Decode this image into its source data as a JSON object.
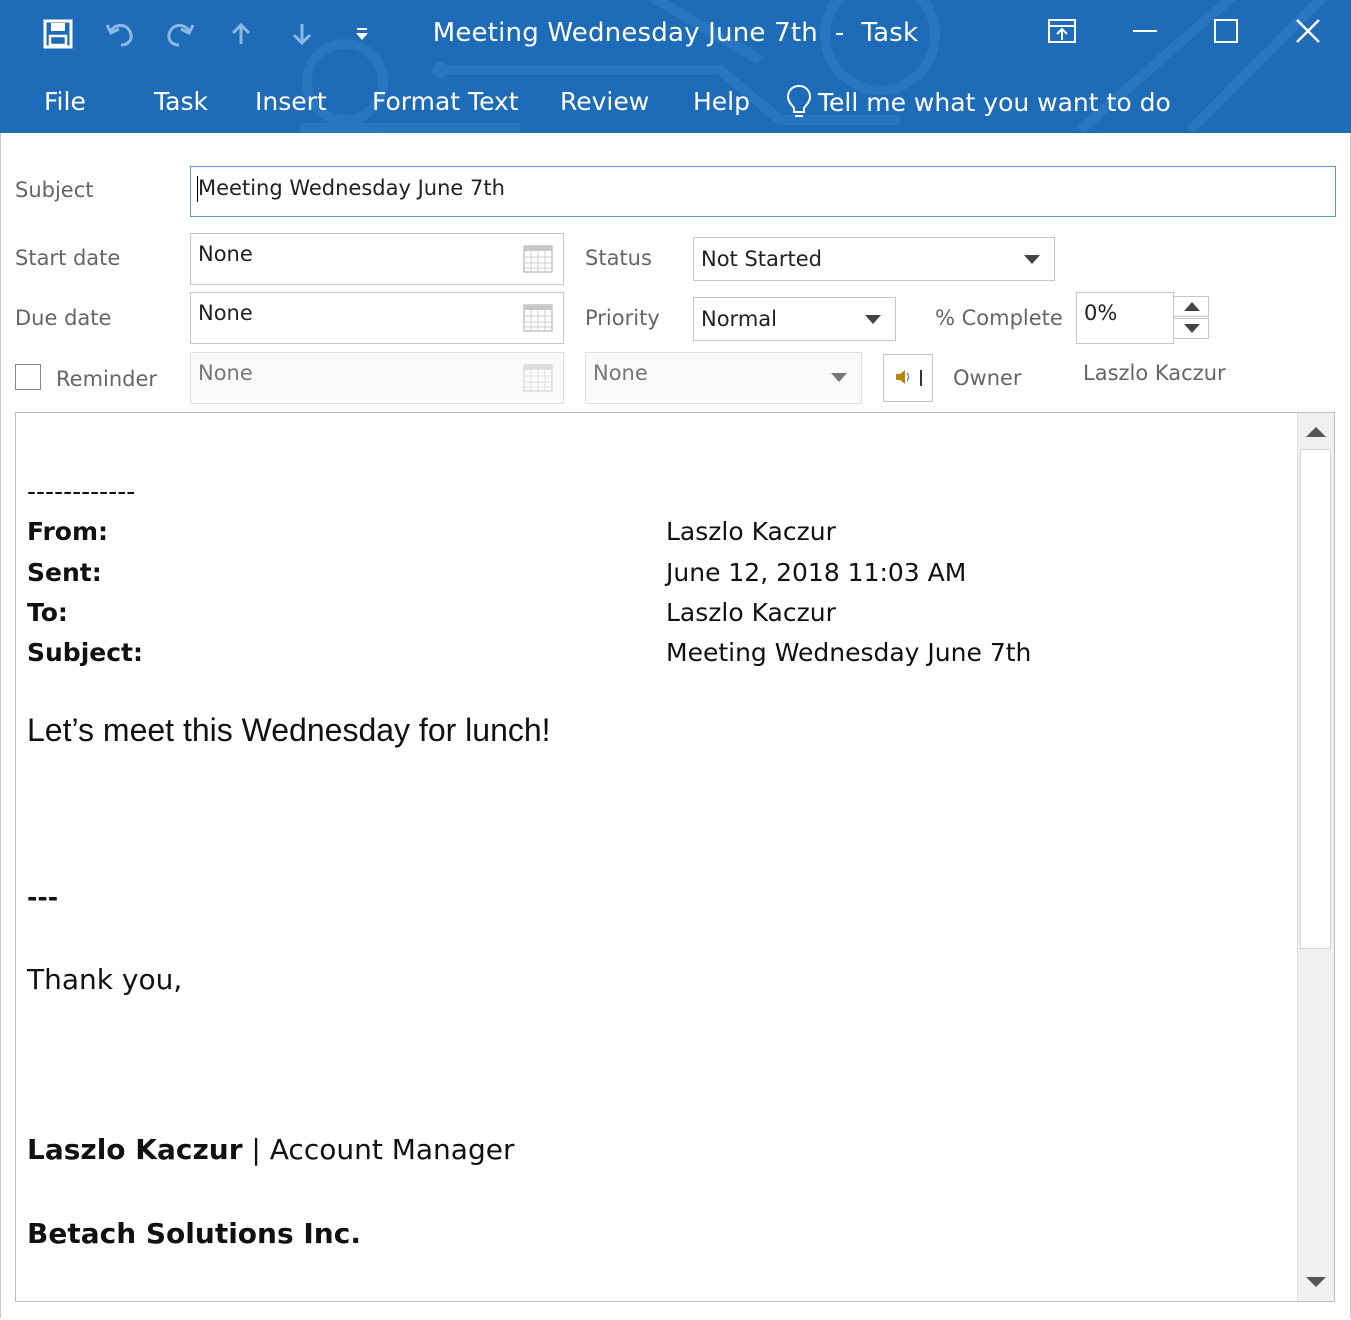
{
  "window": {
    "title_main": "Meeting Wednesday June 7th",
    "title_sep": "-",
    "title_kind": "Task"
  },
  "menu": {
    "items": [
      "File",
      "Task",
      "Insert",
      "Format Text",
      "Review",
      "Help"
    ],
    "tell_me": "Tell me what you want to do"
  },
  "form": {
    "subject_label": "Subject",
    "subject_value": "Meeting Wednesday June 7th",
    "start_label": "Start date",
    "start_value": "None",
    "due_label": "Due date",
    "due_value": "None",
    "reminder_label": "Reminder",
    "reminder_date": "None",
    "reminder_time": "None",
    "reminder_checked": false,
    "status_label": "Status",
    "status_value": "Not Started",
    "priority_label": "Priority",
    "priority_value": "Normal",
    "complete_label": "% Complete",
    "complete_value": "0%",
    "owner_label": "Owner",
    "owner_value": "Laszlo Kaczur"
  },
  "body": {
    "separator": "------------",
    "headers": [
      {
        "key": "From:",
        "value": "Laszlo Kaczur"
      },
      {
        "key": "Sent:",
        "value": "June 12, 2018 11:03 AM"
      },
      {
        "key": "To:",
        "value": "Laszlo Kaczur"
      },
      {
        "key": "Subject:",
        "value": "Meeting Wednesday June 7th"
      }
    ],
    "message": "Let’s meet this Wednesday for lunch!",
    "sig_sep": "---",
    "thanks": "Thank you,",
    "sig_name": "Laszlo Kaczur",
    "sig_bar": "|",
    "sig_title": "Account Manager",
    "company": "Betach Solutions Inc."
  },
  "colors": {
    "ribbon": "#1e6bb8",
    "focus_border": "#5b9bd5"
  },
  "icons": [
    "save-icon",
    "undo-icon",
    "redo-icon",
    "up-arrow-icon",
    "down-arrow-icon",
    "customize-qat-icon",
    "ribbon-display-options-icon",
    "minimize-icon",
    "maximize-icon",
    "close-icon",
    "lightbulb-icon",
    "calendar-icon",
    "sound-icon"
  ]
}
